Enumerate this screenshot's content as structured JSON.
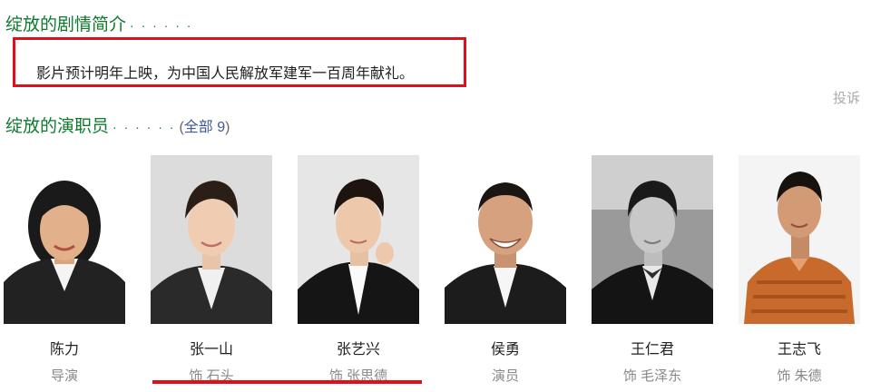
{
  "synopsis": {
    "title": "绽放的剧情简介",
    "dots": "· · · · · ·",
    "text": "影片预计明年上映，为中国人民解放军建军一百周年献礼。",
    "report": "投诉"
  },
  "cast": {
    "title": "绽放的演职员",
    "dots": "· · · · · ·",
    "more_prefix": "(",
    "more_label": "全部 9",
    "more_suffix": ")",
    "members": [
      {
        "name": "陈力",
        "role": "导演"
      },
      {
        "name": "张一山",
        "role": "饰 石头"
      },
      {
        "name": "张艺兴",
        "role": "饰 张思德"
      },
      {
        "name": "侯勇",
        "role": "演员"
      },
      {
        "name": "王仁君",
        "role": "饰 毛泽东"
      },
      {
        "name": "王志飞",
        "role": "饰 朱德"
      }
    ]
  },
  "colors": {
    "accent_green": "#0d7a2e",
    "highlight_red": "#e0101a",
    "link_blue": "#3d5a99"
  }
}
